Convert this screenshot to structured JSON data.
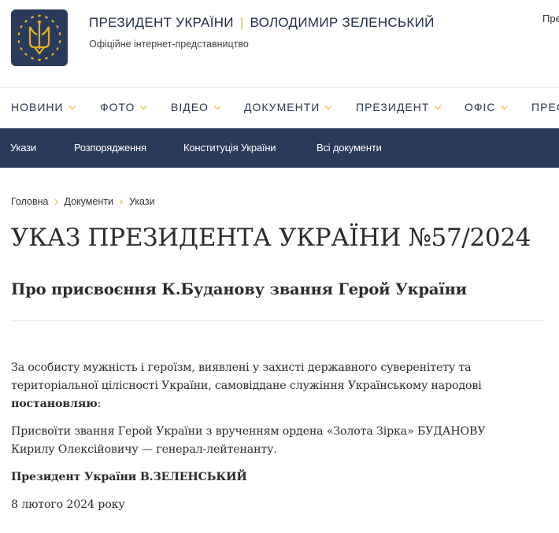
{
  "header": {
    "title_left": "ПРЕЗИДЕНТ УКРАЇНИ",
    "title_right": "ВОЛОДИМИР ЗЕЛЕНСЬКИЙ",
    "subtitle": "Офіційне інтернет-представництво",
    "corner_link": "Пре",
    "logo_icon": "trident-icon",
    "accent_color": "#e3b41c",
    "brand_color": "#293a5b"
  },
  "main_nav": [
    {
      "label": "НОВИНИ"
    },
    {
      "label": "ФОТО"
    },
    {
      "label": "ВІДЕО"
    },
    {
      "label": "ДОКУМЕНТИ"
    },
    {
      "label": "ПРЕЗИДЕНТ"
    },
    {
      "label": "ОФІС"
    },
    {
      "label": "ПРЕС"
    }
  ],
  "sub_nav": [
    {
      "label": "Укази"
    },
    {
      "label": "Розпорядження"
    },
    {
      "label": "Конституція України"
    },
    {
      "label": "Всі документи"
    }
  ],
  "breadcrumb": [
    "Головна",
    "Документи",
    "Укази"
  ],
  "document": {
    "title": "УКАЗ ПРЕЗИДЕНТА УКРАЇНИ №57/2024",
    "subtitle": "Про присвоєння К.Буданову звання Герой України",
    "p1_line1": "За особисту мужність і героїзм, виявлені у захисті державного суверенітету та",
    "p1_line2": "територіальної цілісності України, самовіддане служіння Українському народові",
    "p1_bold": "постановляю",
    "p1_colon": ":",
    "p2_line1": "Присвоїти звання Герой України з врученням ордена «Золота Зірка» БУДАНОВУ",
    "p2_line2": "Кирилу Олексійовичу — генерал-лейтенанту.",
    "signature": "Президент України В.ЗЕЛЕНСЬКИЙ",
    "date": "8 лютого 2024 року"
  }
}
